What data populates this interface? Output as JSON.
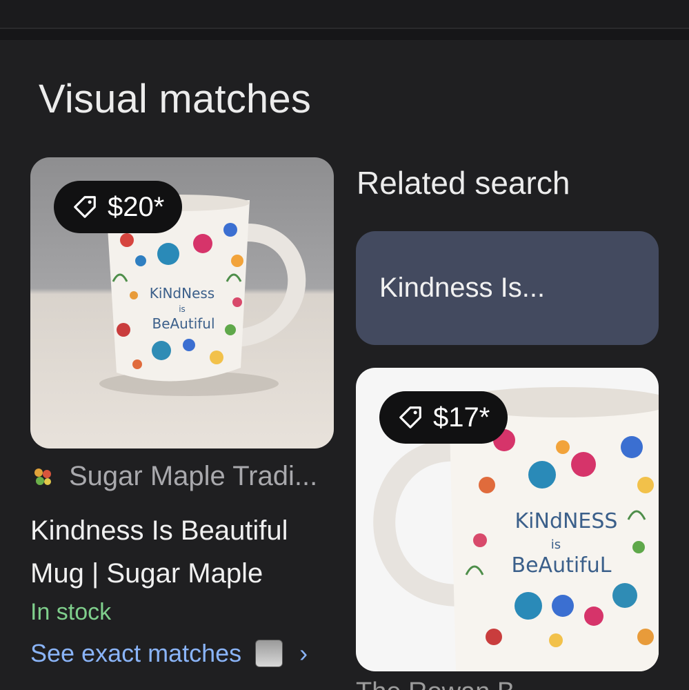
{
  "section": {
    "title": "Visual matches"
  },
  "left_card": {
    "price": "$20*",
    "source_name": "Sugar Maple Tradi...",
    "title": "Kindness Is Beautiful Mug | Sugar Maple",
    "stock": "In stock",
    "exact_link": "See exact matches",
    "mug_text_line1": "KiNdNess",
    "mug_text_line2": "is",
    "mug_text_line3": "BeAutiful"
  },
  "related": {
    "title": "Related search",
    "chip_label": "Kindness Is..."
  },
  "right_card": {
    "price": "$17*",
    "mug_text_line1": "KiNdNESS",
    "mug_text_line2": "is",
    "mug_text_line3": "BeAutifuL"
  },
  "bottom_peek": {
    "text": "The Rowan B..."
  },
  "icons": {
    "price_tag": "tag-icon",
    "source": "flower-logo-icon",
    "chevron": "chevron-right-icon"
  },
  "colors": {
    "background": "#1f1f21",
    "chip_bg": "#434a5f",
    "link": "#8ab4f8",
    "stock": "#7fcf8c"
  }
}
